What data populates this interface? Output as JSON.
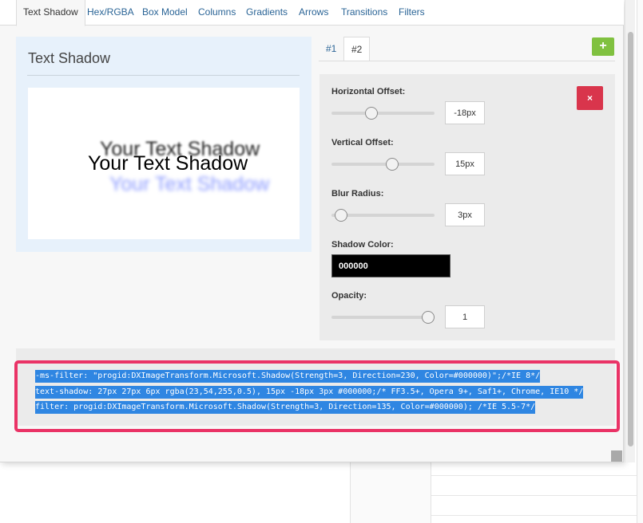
{
  "tabs": [
    "Text Shadow",
    "Hex/RGBA",
    "Box Model",
    "Columns",
    "Gradients",
    "Arrows",
    "Transitions",
    "Filters"
  ],
  "preview": {
    "title": "Text Shadow",
    "sample_text": "Your Text Shadow"
  },
  "shadow_tabs": [
    "#1",
    "#2"
  ],
  "add_label": "+",
  "delete_label": "×",
  "controls": {
    "horizontal_offset": {
      "label": "Horizontal Offset:",
      "value": "-18px",
      "slider_fraction": 0.39
    },
    "vertical_offset": {
      "label": "Vertical Offset:",
      "value": "15px",
      "slider_fraction": 0.59
    },
    "blur_radius": {
      "label": "Blur Radius:",
      "value": "3px",
      "slider_fraction": 0.09
    },
    "shadow_color": {
      "label": "Shadow Color:",
      "value": "000000"
    },
    "opacity": {
      "label": "Opacity:",
      "value": "1",
      "slider_fraction": 0.94
    }
  },
  "code_lines": [
    "-ms-filter: \"progid:DXImageTransform.Microsoft.Shadow(Strength=3, Direction=230, Color=#000000)\";/*IE 8*/",
    "text-shadow: 27px 27px 6px rgba(23,54,255,0.5), 15px -18px 3px #000000;/* FF3.5+, Opera 9+, Saf1+, Chrome, IE10 */",
    "filter: progid:DXImageTransform.Microsoft.Shadow(Strength=3, Direction=135, Color=#000000); /*IE 5.5-7*/"
  ],
  "colors": {
    "accent_link": "#2a6496",
    "add_button": "#80c140",
    "delete_button": "#d9354c",
    "highlight_outline": "#ea3366",
    "selection": "#2f86e2",
    "shadow_blue": "rgba(23,54,255,0.5)"
  }
}
